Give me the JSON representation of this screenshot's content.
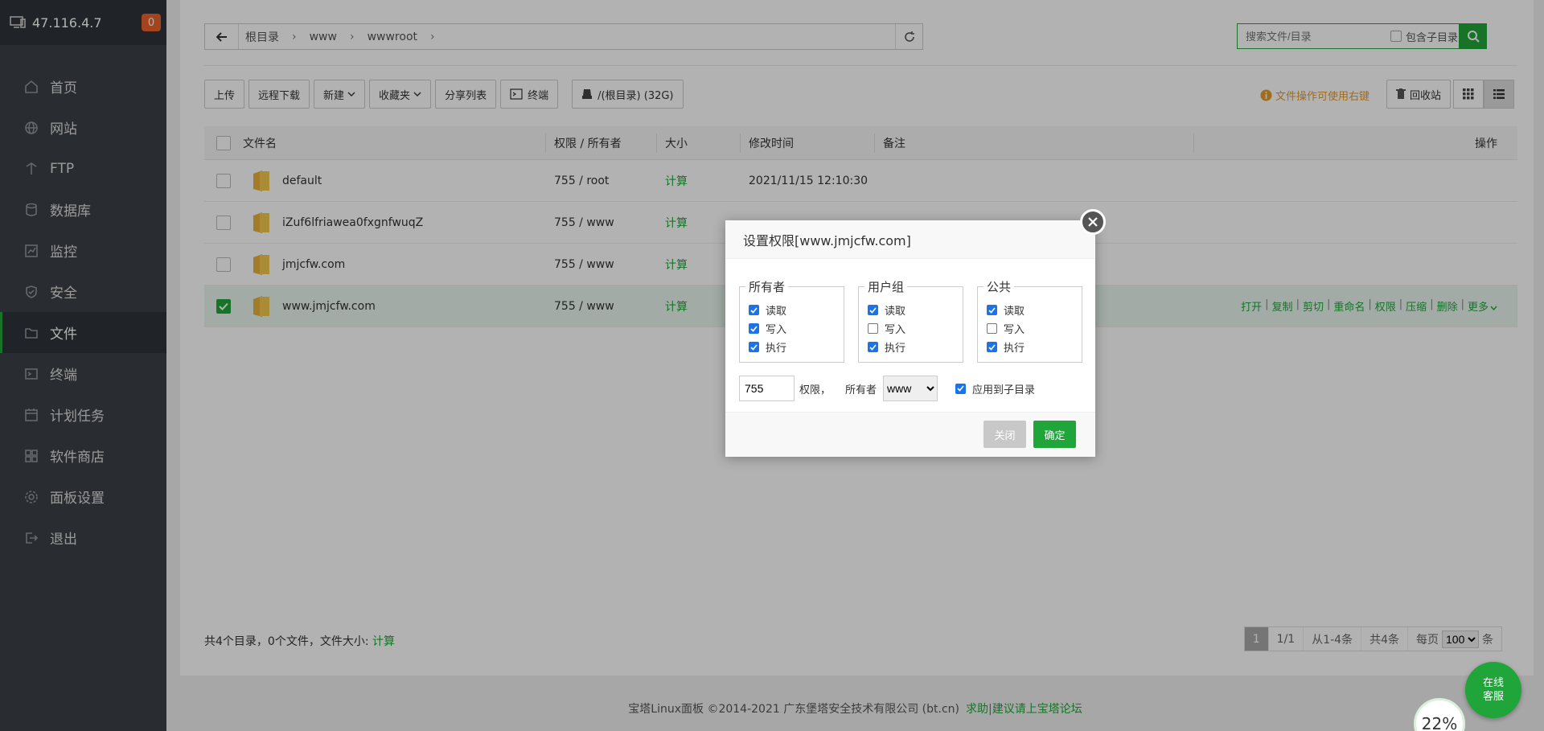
{
  "sidebar": {
    "ip": "47.116.4.7",
    "badge": "0",
    "items": [
      {
        "label": "首页",
        "icon": "home-icon"
      },
      {
        "label": "网站",
        "icon": "globe-icon"
      },
      {
        "label": "FTP",
        "icon": "ftp-icon"
      },
      {
        "label": "数据库",
        "icon": "database-icon"
      },
      {
        "label": "监控",
        "icon": "monitor-icon"
      },
      {
        "label": "安全",
        "icon": "shield-icon"
      },
      {
        "label": "文件",
        "icon": "folder-icon"
      },
      {
        "label": "终端",
        "icon": "terminal-icon"
      },
      {
        "label": "计划任务",
        "icon": "calendar-icon"
      },
      {
        "label": "软件商店",
        "icon": "grid-icon"
      },
      {
        "label": "面板设置",
        "icon": "gear-icon"
      },
      {
        "label": "退出",
        "icon": "logout-icon"
      }
    ]
  },
  "path": {
    "crumbs": [
      "根目录",
      "www",
      "wwwroot"
    ],
    "sep": "›"
  },
  "search": {
    "placeholder": "搜索文件/目录",
    "subdir_label": "包含子目录"
  },
  "toolbar": {
    "upload": "上传",
    "remote": "远程下载",
    "new": "新建",
    "favorites": "收藏夹",
    "share": "分享列表",
    "terminal": "终端",
    "disk": "/(根目录) (32G)"
  },
  "tip": "文件操作可使用右键",
  "recycle": "回收站",
  "table": {
    "headers": {
      "name": "文件名",
      "perm": "权限 / 所有者",
      "size": "大小",
      "time": "修改时间",
      "note": "备注",
      "ops": "操作"
    },
    "rows": [
      {
        "name": "default",
        "perm": "755 / root",
        "size": "计算",
        "time": "2021/11/15 12:10:30"
      },
      {
        "name": "iZuf6lfriawea0fxgnfwuqZ",
        "perm": "755 / www",
        "size": "计算",
        "time": ""
      },
      {
        "name": "jmjcfw.com",
        "perm": "755 / www",
        "size": "计算",
        "time": ""
      },
      {
        "name": "www.jmjcfw.com",
        "perm": "755 / www",
        "size": "计算",
        "time": ""
      }
    ],
    "row_ops": [
      "打开",
      "复制",
      "剪切",
      "重命名",
      "权限",
      "压缩",
      "删除",
      "更多"
    ]
  },
  "footer": {
    "summary_prefix": "共4个目录，0个文件，文件大小: ",
    "summary_link": "计算",
    "pager": {
      "current": "1",
      "pages": "1/1",
      "range": "从1-4条",
      "total": "共4条",
      "per_page_label": "每页",
      "per_page": "100",
      "unit": "条"
    }
  },
  "copyright": "宝塔Linux面板 ©2014-2021 广东堡塔安全技术有限公司 (bt.cn)",
  "copyright_link": "求助|建议请上宝塔论坛",
  "service": {
    "line1": "在线",
    "line2": "客服"
  },
  "progress": "22%",
  "modal": {
    "title": "设置权限[www.jmjcfw.com]",
    "groups": [
      {
        "title": "所有者",
        "read": "读取",
        "write": "写入",
        "exec": "执行",
        "r": true,
        "w": true,
        "x": true
      },
      {
        "title": "用户组",
        "read": "读取",
        "write": "写入",
        "exec": "执行",
        "r": true,
        "w": false,
        "x": true
      },
      {
        "title": "公共",
        "read": "读取",
        "write": "写入",
        "exec": "执行",
        "r": true,
        "w": false,
        "x": true
      }
    ],
    "perm_value": "755",
    "perm_label": "权限，",
    "owner_label": "所有者",
    "owner_value": "www",
    "apply_sub": "应用到子目录",
    "close_btn": "关闭",
    "ok_btn": "确定"
  },
  "colors": {
    "accent": "#20a53a",
    "sidebar": "#3b4047",
    "badge": "#e8622c",
    "tip": "#e59b2b"
  }
}
